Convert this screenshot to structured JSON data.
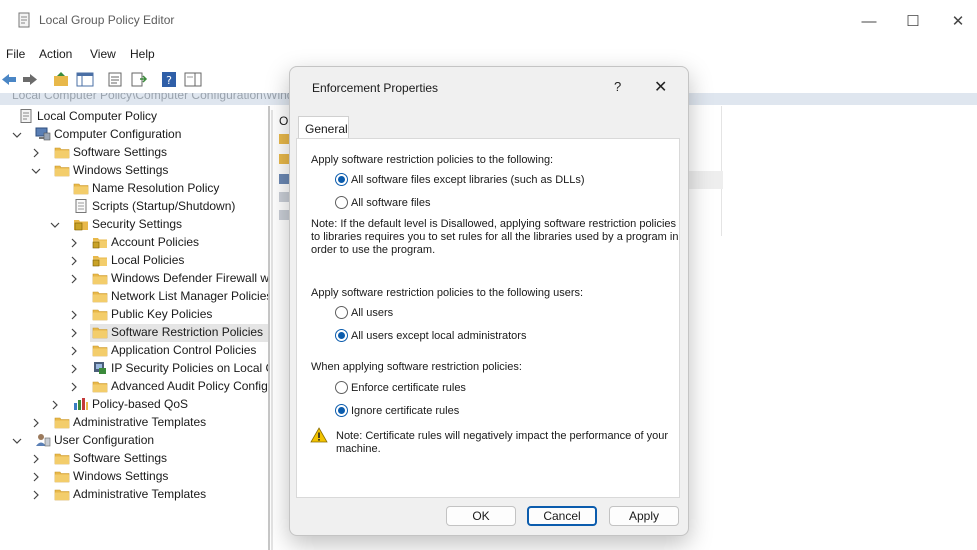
{
  "window": {
    "title": "Local Group Policy Editor",
    "controls": {
      "minimize": "—",
      "maximize": "☐",
      "close": "✕"
    }
  },
  "menu": [
    "File",
    "Action",
    "View",
    "Help"
  ],
  "path_strip": "Local Computer Policy\\Computer Configuration\\Windows",
  "tree": [
    {
      "label": "Local Computer Policy",
      "icon": "policy-icon",
      "level": 0,
      "chevron": "none"
    },
    {
      "label": "Computer Configuration",
      "icon": "computer-icon",
      "level": 1,
      "chevron": "down"
    },
    {
      "label": "Software Settings",
      "icon": "folder-icon",
      "level": 2,
      "chevron": "right"
    },
    {
      "label": "Windows Settings",
      "icon": "folder-icon",
      "level": 2,
      "chevron": "down"
    },
    {
      "label": "Name Resolution Policy",
      "icon": "folder-icon",
      "level": 3,
      "chevron": "none"
    },
    {
      "label": "Scripts (Startup/Shutdown)",
      "icon": "script-icon",
      "level": 3,
      "chevron": "none"
    },
    {
      "label": "Security Settings",
      "icon": "security-icon",
      "level": 3,
      "chevron": "down"
    },
    {
      "label": "Account Policies",
      "icon": "locked-folder-icon",
      "level": 4,
      "chevron": "right"
    },
    {
      "label": "Local Policies",
      "icon": "locked-folder-icon",
      "level": 4,
      "chevron": "right"
    },
    {
      "label": "Windows Defender Firewall wit",
      "icon": "folder-icon",
      "level": 4,
      "chevron": "right"
    },
    {
      "label": "Network List Manager Policies",
      "icon": "folder-icon",
      "level": 4,
      "chevron": "none"
    },
    {
      "label": "Public Key Policies",
      "icon": "folder-icon",
      "level": 4,
      "chevron": "right"
    },
    {
      "label": "Software Restriction Policies",
      "icon": "folder-icon",
      "level": 4,
      "chevron": "right",
      "selected": true
    },
    {
      "label": "Application Control Policies",
      "icon": "folder-icon",
      "level": 4,
      "chevron": "right"
    },
    {
      "label": "IP Security Policies on Local Co",
      "icon": "ip-security-icon",
      "level": 4,
      "chevron": "right"
    },
    {
      "label": "Advanced Audit Policy Config",
      "icon": "folder-icon",
      "level": 4,
      "chevron": "right"
    },
    {
      "label": "Policy-based QoS",
      "icon": "qos-chart-icon",
      "level": 3,
      "chevron": "right"
    },
    {
      "label": "Administrative Templates",
      "icon": "folder-icon",
      "level": 2,
      "chevron": "right"
    },
    {
      "label": "User Configuration",
      "icon": "user-icon",
      "level": 1,
      "chevron": "down"
    },
    {
      "label": "Software Settings",
      "icon": "folder-icon",
      "level": 2,
      "chevron": "right"
    },
    {
      "label": "Windows Settings",
      "icon": "folder-icon",
      "level": 2,
      "chevron": "right"
    },
    {
      "label": "Administrative Templates",
      "icon": "folder-icon",
      "level": 2,
      "chevron": "right"
    }
  ],
  "right_pane": {
    "header_fragment": "O"
  },
  "dialog": {
    "title": "Enforcement Properties",
    "help": "?",
    "close": "✕",
    "tab": "General",
    "section1_heading": "Apply software restriction policies to the following:",
    "opt_all_except_libs": "All software files except libraries (such as DLLs)",
    "opt_all_files": "All software files",
    "note1_line1": "Note:  If the default level is Disallowed, applying software restriction policies",
    "note1_line2": "to libraries requires you to set rules for all the libraries used by a program in",
    "note1_line3": "order to use the program.",
    "section2_heading": "Apply software restriction policies to the following users:",
    "opt_all_users": "All users",
    "opt_all_except_admins": "All users except local administrators",
    "section3_heading": "When applying software restriction policies:",
    "opt_enforce_cert": "Enforce certificate rules",
    "opt_ignore_cert": "Ignore certificate rules",
    "note2_line1": "Note:  Certificate rules will negatively impact the performance of your",
    "note2_line2": "machine.",
    "btn_ok": "OK",
    "btn_cancel": "Cancel",
    "btn_apply": "Apply"
  },
  "colors": {
    "accent": "#0b5cad",
    "folder": "#e8b84a",
    "selection": "#e5e5e5"
  }
}
